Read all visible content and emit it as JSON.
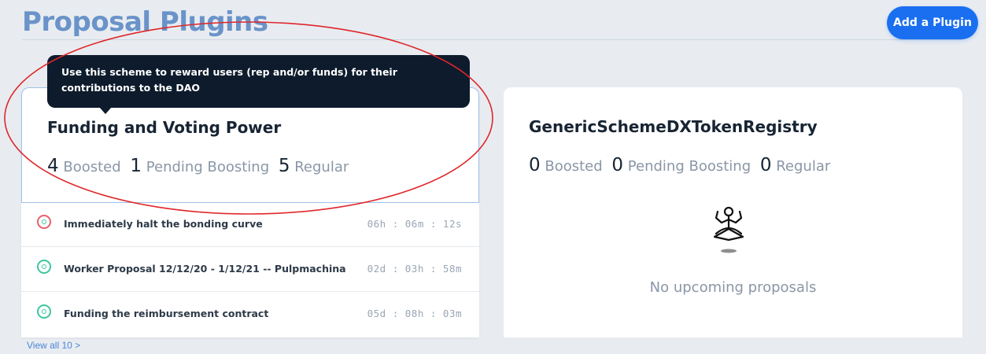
{
  "header": {
    "title": "Proposal Plugins",
    "add_button_label": "Add a Plugin"
  },
  "tooltip": {
    "text": "Use this scheme to reward users (rep and/or funds) for their contributions to the DAO"
  },
  "plugins": [
    {
      "title": "Funding and Voting Power",
      "boosted_count": "4",
      "boosted_label": "Boosted",
      "pending_count": "1",
      "pending_label": "Pending Boosting",
      "regular_count": "5",
      "regular_label": "Regular",
      "proposals": [
        {
          "title": "Immediately halt the bonding curve",
          "time": "06h : 06m : 12s",
          "status_icon": "thumbs-up-alert-icon"
        },
        {
          "title": "Worker Proposal 12/12/20 - 1/12/21 -- Pulpmachina",
          "time": "02d : 03h : 58m",
          "status_icon": "thumbs-up-icon"
        },
        {
          "title": "Funding the reimbursement contract",
          "time": "05d : 08h : 03m",
          "status_icon": "thumbs-up-icon"
        }
      ],
      "view_all_label": "View all 10 >"
    },
    {
      "title": "GenericSchemeDXTokenRegistry",
      "boosted_count": "0",
      "boosted_label": "Boosted",
      "pending_count": "0",
      "pending_label": "Pending Boosting",
      "regular_count": "0",
      "regular_label": "Regular",
      "empty_icon": "meditating-person-icon",
      "empty_text": "No upcoming proposals"
    }
  ],
  "colors": {
    "accent": "#1a6ff0",
    "title": "#6a93c9",
    "tooltip_bg": "#0d1b2c",
    "annotation": "#e0262a",
    "icon_green": "#3fc6a0",
    "icon_red": "#e8606b"
  }
}
